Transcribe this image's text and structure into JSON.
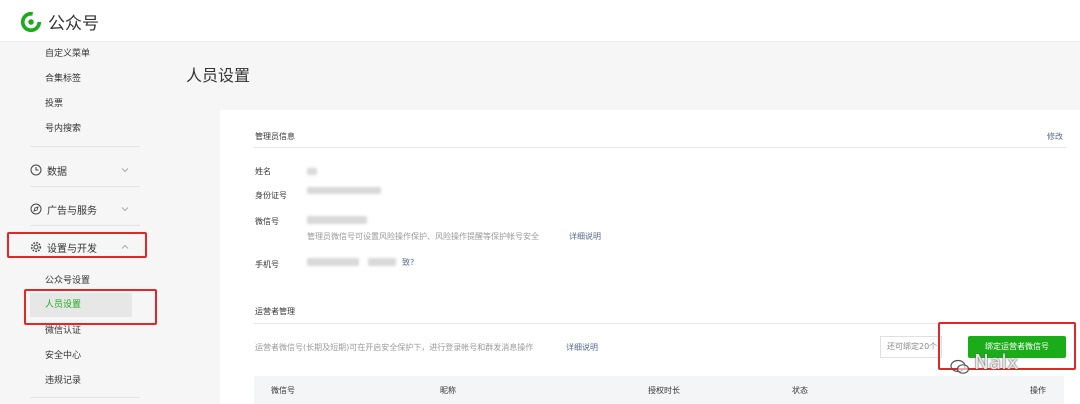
{
  "header": {
    "brand": "公众号"
  },
  "sidebar": {
    "top_items": [
      "自定义菜单",
      "合集标签",
      "投票",
      "号内搜索"
    ],
    "sections": [
      {
        "label": "数据",
        "icon": "clock-icon"
      },
      {
        "label": "广告与服务",
        "icon": "compass-icon"
      },
      {
        "label": "设置与开发",
        "icon": "gear-icon"
      }
    ],
    "settings_items": [
      "公众号设置",
      "人员设置",
      "微信认证",
      "安全中心",
      "违规记录"
    ]
  },
  "main": {
    "page_title": "人员设置",
    "admin": {
      "heading": "管理员信息",
      "edit_link": "修改",
      "fields": {
        "name": "姓名",
        "id_number": "身份证号",
        "wechat_id": "微信号",
        "phone": "手机号"
      },
      "wechat_hint": "管理员微信号可设置风险操作保护、风险操作提醒等保护帐号安全",
      "wechat_hint_link": "详细说明",
      "phone_tail": "致?"
    },
    "operators": {
      "heading": "运营者管理",
      "description": "运营者微信号(长期及短期)可在开启安全保护下，进行登录帐号和群发消息操作",
      "description_link": "详细说明",
      "bind_remaining": "还可绑定20个",
      "bind_button": "绑定运营者微信号",
      "columns": [
        "微信号",
        "昵称",
        "授权时长",
        "状态",
        "操作"
      ]
    }
  },
  "watermark": "Nalx",
  "colors": {
    "accent": "#1aad19",
    "link": "#576b95",
    "highlight": "#e3262a"
  }
}
